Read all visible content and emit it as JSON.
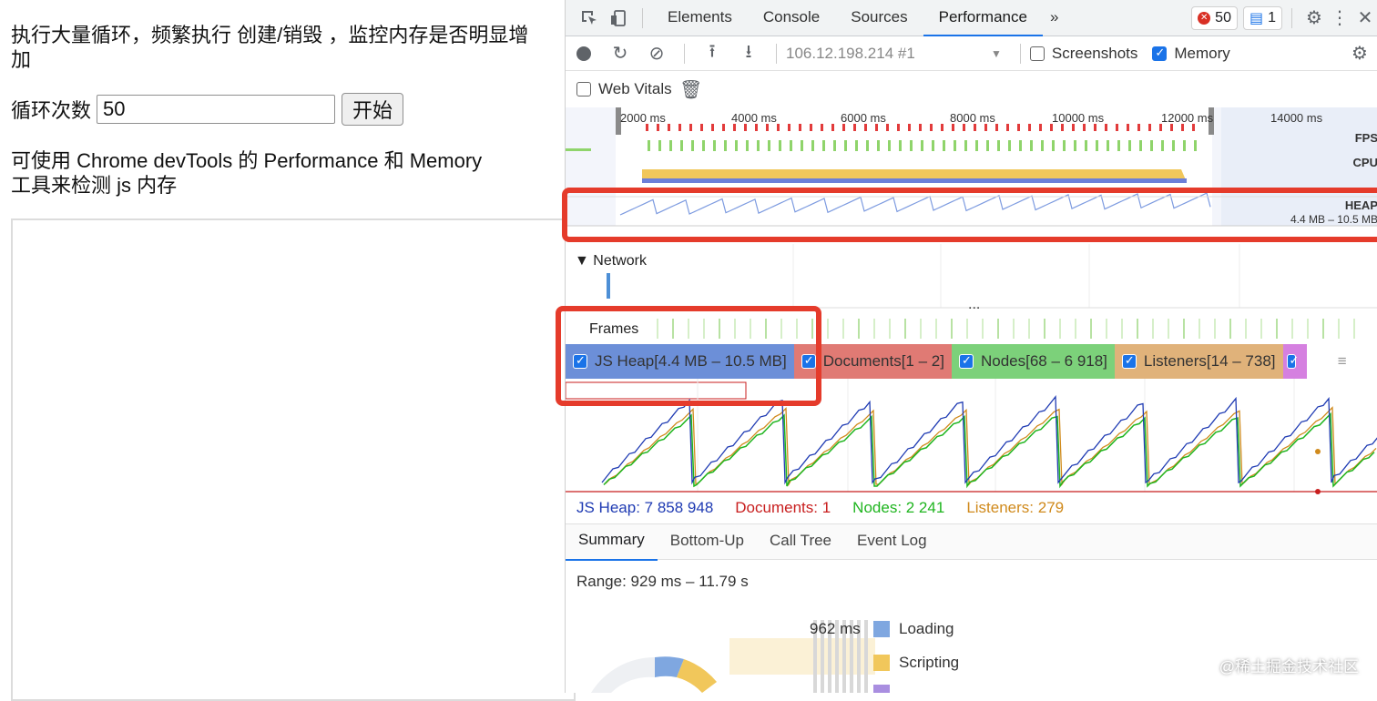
{
  "page": {
    "heading": "执行大量循环，频繁执行 创建/销毁 ，监控内存是否明显增加",
    "loop_label": "循环次数",
    "loop_value": "50",
    "start_button": "开始",
    "hint": "可使用 Chrome devTools 的 Performance 和 Memory 工具来检测 js 内存"
  },
  "devtools": {
    "tabs": [
      "Elements",
      "Console",
      "Sources",
      "Performance"
    ],
    "active_tab": "Performance",
    "more_tabs": "»",
    "error_count": "50",
    "message_count": "1",
    "recording_target": "106.12.198.214 #1",
    "screenshots_label": "Screenshots",
    "memory_label": "Memory",
    "web_vitals_label": "Web Vitals",
    "overview": {
      "ruler": [
        "2000 ms",
        "4000 ms",
        "6000 ms",
        "8000 ms",
        "10000 ms",
        "12000 ms",
        "14000 ms"
      ],
      "fps_label": "FPS",
      "cpu_label": "CPU",
      "heap_label": "HEAP",
      "heap_range": "4.4 MB – 10.5 MB"
    },
    "network_label": "Network",
    "frames_label": "Frames",
    "more_indicator": "...",
    "counters": [
      {
        "label": "JS Heap[4.4 MB – 10.5 MB]",
        "color": "#6c8fd8"
      },
      {
        "label": "Documents[1 – 2]",
        "color": "#e07a74"
      },
      {
        "label": "Nodes[68 – 6 918]",
        "color": "#7cd17a"
      },
      {
        "label": "Listeners[14 – 738]",
        "color": "#e0b27a"
      }
    ],
    "legend": {
      "js_heap": "JS Heap: 7 858 948",
      "documents": "Documents: 1",
      "nodes": "Nodes: 2 241",
      "listeners": "Listeners: 279"
    },
    "bottom_tabs": [
      "Summary",
      "Bottom-Up",
      "Call Tree",
      "Event Log"
    ],
    "range": "Range: 929 ms – 11.79 s",
    "summary": {
      "value": "962 ms",
      "items": [
        {
          "label": "Loading",
          "color": "#7fa7e0"
        },
        {
          "label": "Scripting",
          "color": "#f1c75b"
        }
      ]
    }
  },
  "watermark": "@稀土掘金技术社区",
  "colors": {
    "accent": "#1a73e8",
    "highlight": "#e53b2b",
    "heap": "#1f3bb3",
    "nodes": "#1fb51f",
    "listeners": "#d08a1c",
    "documents": "#c81e1e"
  }
}
